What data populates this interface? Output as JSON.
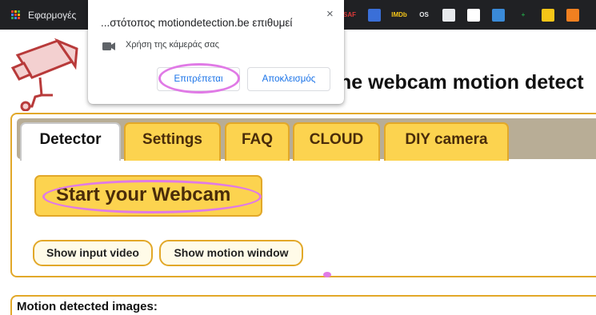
{
  "bookmarks_bar": {
    "apps_label": "Εφαρμογές",
    "icons": [
      {
        "name": "bookmark-saf-icon",
        "text": "SAF",
        "color": "#e03a3a"
      },
      {
        "name": "bookmark-runner-icon",
        "text": "",
        "color": "#3a6fd8"
      },
      {
        "name": "bookmark-imdb-icon",
        "text": "IMDb",
        "color": "#f5c518"
      },
      {
        "name": "bookmark-os-icon",
        "text": "OS",
        "color": "#e8eaed"
      },
      {
        "name": "bookmark-search-icon",
        "text": "",
        "color": "#e8eaed"
      },
      {
        "name": "bookmark-document-icon",
        "text": "",
        "color": "#ffffff"
      },
      {
        "name": "bookmark-clapper-icon",
        "text": "",
        "color": "#3a8ad8"
      },
      {
        "name": "bookmark-sheets-plus-icon",
        "text": "+",
        "color": "#22a045"
      },
      {
        "name": "bookmark-smile-icon",
        "text": "",
        "color": "#f5c518"
      },
      {
        "name": "bookmark-orange-icon",
        "text": "",
        "color": "#f08020"
      }
    ]
  },
  "popup": {
    "title": "...στότοπος motiondetection.be επιθυμεί",
    "close_label": "×",
    "permission_text": "Χρήση της κάμεράς σας",
    "allow_label": "Επιτρέπεται",
    "block_label": "Αποκλεισμός"
  },
  "site": {
    "title_fragment": "he webcam motion detect",
    "tabs": [
      {
        "label": "Detector",
        "active": true
      },
      {
        "label": "Settings",
        "active": false
      },
      {
        "label": "FAQ",
        "active": false
      },
      {
        "label": "CLOUD",
        "active": false
      },
      {
        "label": "DIY camera",
        "active": false
      }
    ],
    "start_button": "Start your Webcam",
    "show_input_video": "Show input video",
    "show_motion_window": "Show motion window",
    "motion_section_label": "Motion detected images:"
  },
  "colors": {
    "accent_yellow": "#fcd34f",
    "accent_border": "#e2a829",
    "annotation_pink": "#e07ae6",
    "link_blue": "#1a73e8"
  }
}
